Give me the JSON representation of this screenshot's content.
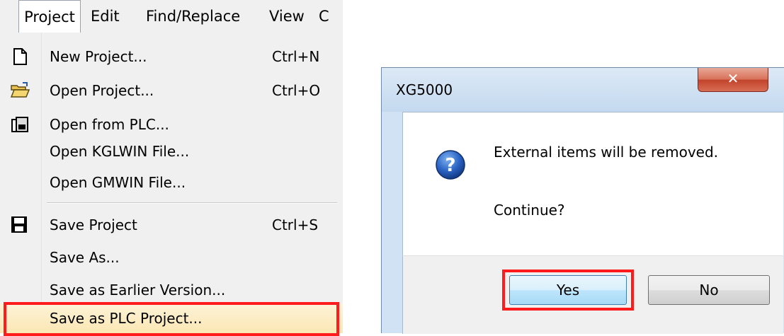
{
  "menubar": {
    "items": [
      "Project",
      "Edit",
      "Find/Replace",
      "View",
      "C"
    ]
  },
  "menu": {
    "items": [
      {
        "label": "New Project...",
        "shortcut": "Ctrl+N",
        "icon": "new-page-icon"
      },
      {
        "label": "Open Project...",
        "shortcut": "Ctrl+O",
        "icon": "open-folder-icon"
      },
      {
        "label": "Open from PLC...",
        "shortcut": "",
        "icon": "plc-open-icon"
      },
      {
        "label": "Open KGLWIN File...",
        "shortcut": "",
        "icon": ""
      },
      {
        "label": "Open GMWIN File...",
        "shortcut": "",
        "icon": ""
      },
      {
        "label": "Save Project",
        "shortcut": "Ctrl+S",
        "icon": "floppy-disk-icon"
      },
      {
        "label": "Save As...",
        "shortcut": "",
        "icon": ""
      },
      {
        "label": "Save as Earlier Version...",
        "shortcut": "",
        "icon": ""
      },
      {
        "label": "Save as PLC Project...",
        "shortcut": "",
        "icon": ""
      }
    ],
    "highlight_color": "#ff1b1b"
  },
  "dialog": {
    "title": "XG5000",
    "message_line1": "External items will be removed.",
    "message_line2": "Continue?",
    "yes_label": "Yes",
    "no_label": "No",
    "icon": "question-icon"
  }
}
